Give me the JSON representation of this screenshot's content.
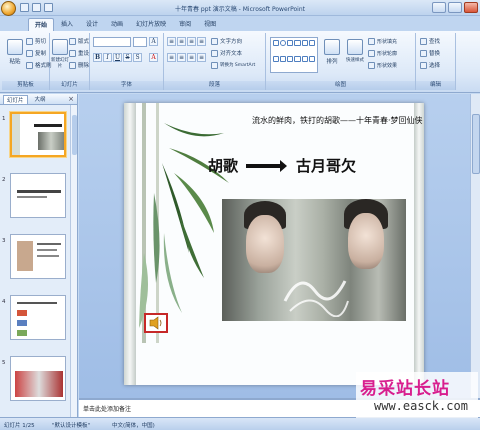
{
  "window": {
    "title": "十年青春 ppt 演示文稿 - Microsoft PowerPoint"
  },
  "tabs": [
    {
      "label": "开始",
      "active": true
    },
    {
      "label": "插入",
      "active": false
    },
    {
      "label": "设计",
      "active": false
    },
    {
      "label": "动画",
      "active": false
    },
    {
      "label": "幻灯片放映",
      "active": false
    },
    {
      "label": "审阅",
      "active": false
    },
    {
      "label": "视图",
      "active": false
    }
  ],
  "ribbon": {
    "clipboard": {
      "paste": "粘贴",
      "cut": "剪切",
      "copy": "复制",
      "format_painter": "格式刷",
      "label": "剪贴板"
    },
    "slides": {
      "new_slide": "新建幻灯片",
      "layout": "版式",
      "reset": "重设",
      "delete": "删除",
      "label": "幻灯片"
    },
    "font": {
      "label": "字体"
    },
    "paragraph": {
      "text_direction": "文字方向",
      "align_text": "对齐文本",
      "smartart": "转换为 SmartArt",
      "label": "段落"
    },
    "drawing": {
      "arrange": "排列",
      "quick_styles": "快速样式",
      "shape_fill": "形状填充",
      "shape_outline": "形状轮廓",
      "shape_effects": "形状效果",
      "label": "绘图"
    },
    "editing": {
      "find": "查找",
      "replace": "替换",
      "select": "选择",
      "label": "编辑"
    }
  },
  "left_pane": {
    "tab_slides": "幻灯片",
    "tab_outline": "大纲",
    "close_icon": "close-icon",
    "thumb_numbers": [
      "1",
      "2",
      "3",
      "4",
      "5"
    ]
  },
  "slide": {
    "tagline": "流水的鲜肉，铁打的胡歌——十年青春·梦回仙侠",
    "heading_left": "胡歌",
    "heading_right": "古月哥欠"
  },
  "notes": {
    "placeholder": "单击此处添加备注"
  },
  "status": {
    "slide_counter": "幻灯片 1/25",
    "theme": "\"默认设计模板\"",
    "language": "中文(简体，中国)"
  },
  "watermark": {
    "brand": "易采站长站",
    "url": "www.easck.com"
  },
  "colors": {
    "accent": "#f5a623",
    "speaker_border": "#c62828",
    "watermark_pink": "#d81e8e"
  }
}
